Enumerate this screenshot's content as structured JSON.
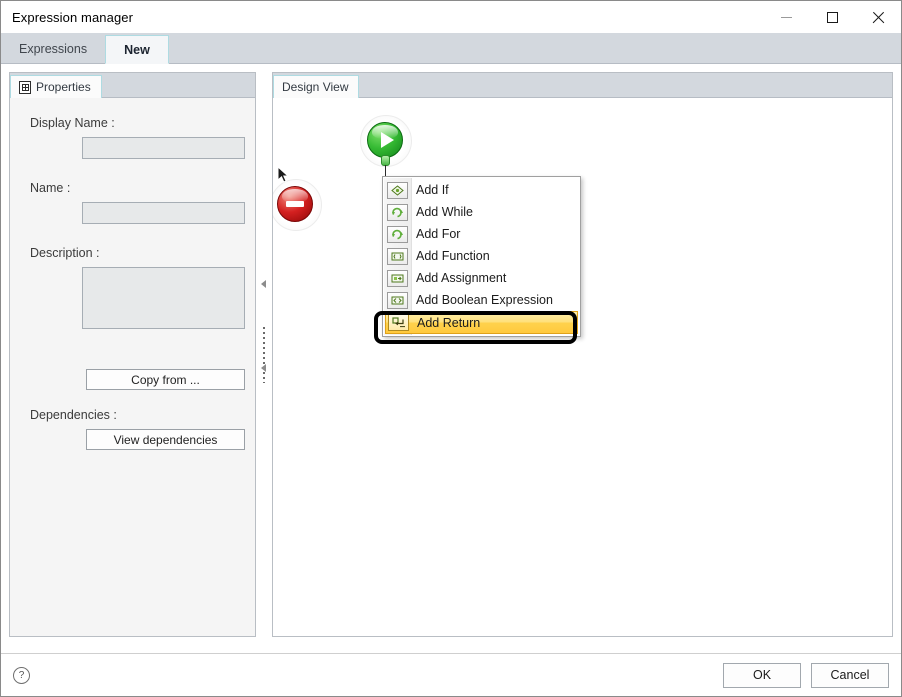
{
  "window": {
    "title": "Expression manager",
    "controls": {
      "minimize": "minimize-button",
      "maximize": "maximize-button",
      "close": "close-button"
    }
  },
  "tabs": [
    {
      "label": "Expressions",
      "active": false
    },
    {
      "label": "New",
      "active": true
    }
  ],
  "left_panel": {
    "tab_label": "Properties",
    "fields": [
      {
        "label": "Display Name :",
        "value": "",
        "type": "text"
      },
      {
        "label": "Name :",
        "value": "",
        "type": "text"
      },
      {
        "label": "Description :",
        "value": "",
        "type": "textarea"
      }
    ],
    "copy_from_button": "Copy from ...",
    "dependencies_label": "Dependencies :",
    "view_dependencies_button": "View dependencies"
  },
  "right_panel": {
    "tab_label": "Design View",
    "nodes": [
      {
        "name": "start-node",
        "type": "start",
        "glyph": "play"
      },
      {
        "name": "end-node",
        "type": "end",
        "glyph": "stop"
      }
    ]
  },
  "context_menu": {
    "items": [
      {
        "label": "Add If",
        "icon": "add-if-icon",
        "selected": false
      },
      {
        "label": "Add While",
        "icon": "add-while-icon",
        "selected": false
      },
      {
        "label": "Add For",
        "icon": "add-for-icon",
        "selected": false
      },
      {
        "label": "Add Function",
        "icon": "add-function-icon",
        "selected": false
      },
      {
        "label": "Add Assignment",
        "icon": "add-assignment-icon",
        "selected": false
      },
      {
        "label": "Add Boolean Expression",
        "icon": "add-boolean-expression-icon",
        "selected": false
      },
      {
        "label": "Add Return",
        "icon": "add-return-icon",
        "selected": true
      }
    ],
    "highlight_color": "#ffd24d",
    "annotation_color": "#000000"
  },
  "footer": {
    "help": "?",
    "ok_button": "OK",
    "cancel_button": "Cancel"
  }
}
